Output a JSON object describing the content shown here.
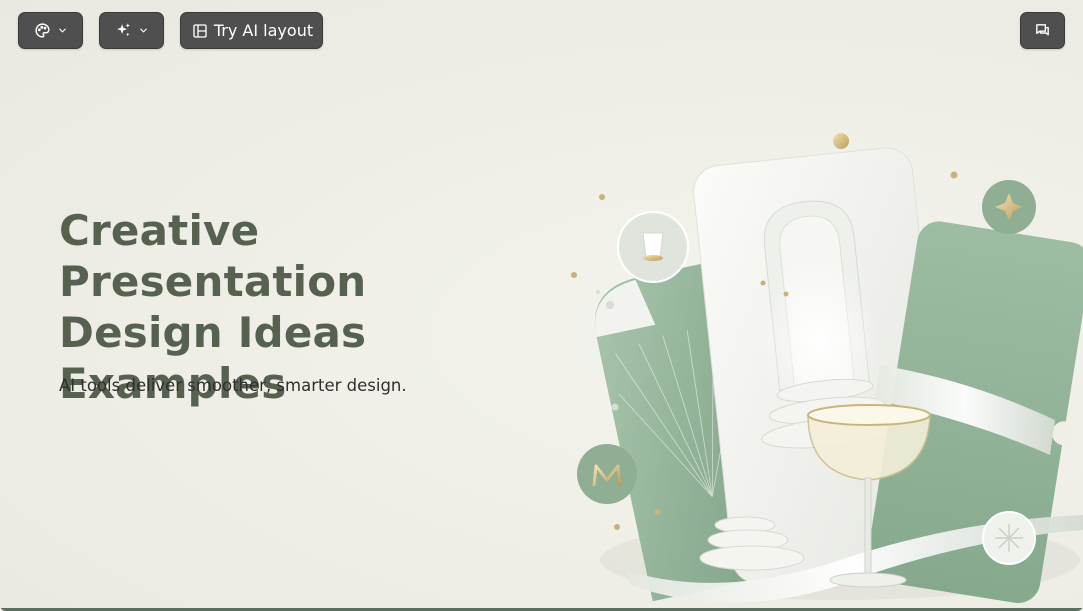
{
  "toolbar": {
    "theme_icon": "palette-icon",
    "ai_icon": "sparkle-icon",
    "layout_icon": "layout-icon",
    "layout_label": "Try AI layout",
    "comment_icon": "comment-icon"
  },
  "slide": {
    "title_lines": [
      "Creative Presentation",
      "Design Ideas",
      "Examples"
    ],
    "subtitle": "AI tools deliver smoother, smarter design."
  },
  "colors": {
    "title": "#56614f",
    "sage": "#8fb197",
    "toolbar_bg": "#4f4f4f"
  }
}
